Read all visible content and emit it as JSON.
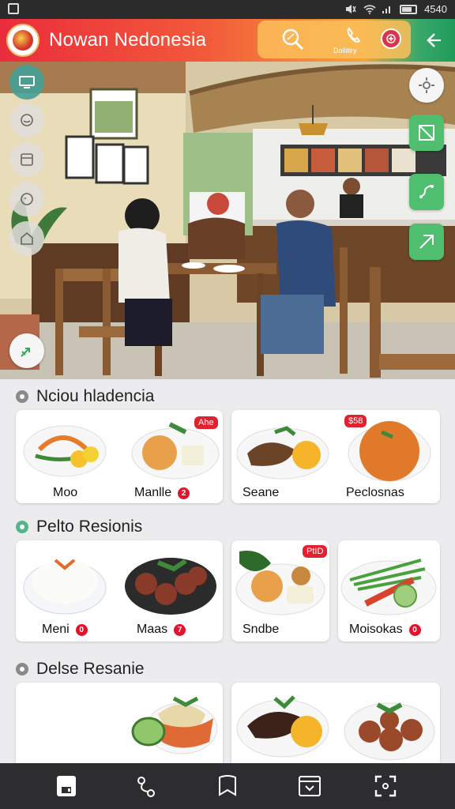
{
  "status_bar": {
    "right_text": "4540"
  },
  "app": {
    "title": "Nowan Nedonesia",
    "pill_label": "Dollitlry"
  },
  "sections": [
    {
      "title": "Nciou hladencia",
      "items": [
        {
          "name": "Moo",
          "badge": ""
        },
        {
          "name": "Manlle",
          "badge": "2",
          "price": "Ahe"
        },
        {
          "name": "Seane",
          "badge": ""
        },
        {
          "name": "Peclosnas",
          "badge": "",
          "price": "$58"
        }
      ]
    },
    {
      "title": "Pelto Resionis",
      "items": [
        {
          "name": "Meni",
          "badge": "0"
        },
        {
          "name": "Maas",
          "badge": "7"
        },
        {
          "name": "Sndbe",
          "badge": "",
          "price": "PtID"
        },
        {
          "name": "Moisokas",
          "badge": "0"
        }
      ]
    },
    {
      "title": "Delse Resanie",
      "items": []
    }
  ],
  "colors": {
    "brand_red": "#ea2d3c",
    "brand_orange": "#f5a43a",
    "brand_green": "#4fbe6f",
    "badge_red": "#e0142c"
  },
  "icons": {
    "side_left": [
      "monitor-icon",
      "sticker-icon",
      "card-icon",
      "smile-icon",
      "home-icon",
      "share-icon"
    ],
    "side_right": [
      "settings-icon",
      "map-icon",
      "route-icon",
      "map-pin-icon"
    ],
    "bottom_nav": [
      "save-icon",
      "share-icon",
      "bookmark-icon",
      "download-icon",
      "scan-icon"
    ]
  }
}
